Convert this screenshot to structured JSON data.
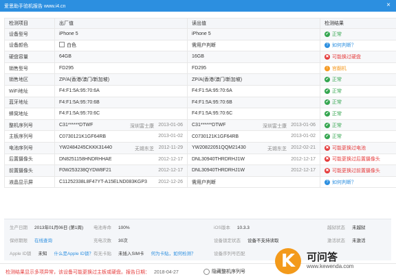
{
  "window": {
    "title": "爱思助手验机报告 www.i4.cn",
    "close": "×"
  },
  "table": {
    "headers": [
      "检测项目",
      "出厂值",
      "读出值",
      "检测结果"
    ],
    "rows": [
      {
        "item": "设备型号",
        "factory": "iPhone 5",
        "factory_note": "",
        "factory_date": "",
        "read": "iPhone 5",
        "read_note": "",
        "read_date": "",
        "result": "正常",
        "status": "ok",
        "checkbox": false
      },
      {
        "item": "设备颜色",
        "factory": "白色",
        "factory_note": "",
        "factory_date": "",
        "read": "需用户判断",
        "read_note": "",
        "read_date": "",
        "result": "如何判断？",
        "status": "q",
        "checkbox": true
      },
      {
        "item": "硬盘容量",
        "factory": "64GB",
        "factory_note": "",
        "factory_date": "",
        "read": "16GB",
        "read_note": "",
        "read_date": "",
        "result": "可能换过硬盘",
        "status": "bad",
        "checkbox": false
      },
      {
        "item": "销售型号",
        "factory": "FD295",
        "factory_note": "",
        "factory_date": "",
        "read": "FD295",
        "read_note": "",
        "read_date": "",
        "result": "官翻机",
        "status": "warn",
        "checkbox": false
      },
      {
        "item": "销售地区",
        "factory": "ZP/A(香港/澳门/新加坡)",
        "factory_note": "",
        "factory_date": "",
        "read": "ZP/A(香港/澳门/新加坡)",
        "read_note": "",
        "read_date": "",
        "result": "正常",
        "status": "ok",
        "checkbox": false
      },
      {
        "item": "WiFi地址",
        "factory": "F4:F1:5A:95:70:6A",
        "factory_note": "",
        "factory_date": "",
        "read": "F4:F1:5A:95:70:6A",
        "read_note": "",
        "read_date": "",
        "result": "正常",
        "status": "ok",
        "checkbox": false
      },
      {
        "item": "蓝牙地址",
        "factory": "F4:F1:5A:95:70:6B",
        "factory_note": "",
        "factory_date": "",
        "read": "F4:F1:5A:95:70:6B",
        "read_note": "",
        "read_date": "",
        "result": "正常",
        "status": "ok",
        "checkbox": false
      },
      {
        "item": "蜂窝地址",
        "factory": "F4:F1:5A:95:70:6C",
        "factory_note": "",
        "factory_date": "",
        "read": "F4:F1:5A:95:70:6C",
        "read_note": "",
        "read_date": "",
        "result": "正常",
        "status": "ok",
        "checkbox": false
      },
      {
        "item": "整机序列号",
        "factory": "C31******DTWF",
        "factory_note": "深圳富士康",
        "factory_date": "2013-01-06",
        "read": "C31******DTWF",
        "read_note": "深圳富士康",
        "read_date": "2013-01-06",
        "result": "正常",
        "status": "ok",
        "checkbox": false
      },
      {
        "item": "主板序列号",
        "factory": "C0730121K1GF64RB",
        "factory_note": "",
        "factory_date": "2013-01-02",
        "read": "C0730121K1GF64RB",
        "read_note": "",
        "read_date": "2013-01-02",
        "result": "正常",
        "status": "ok",
        "checkbox": false
      },
      {
        "item": "电池序列号",
        "factory": "YW2484245CKKK31440",
        "factory_note": "无锡东芝",
        "factory_date": "2012-11-29",
        "read": "YW20822051QQM21430",
        "read_note": "无锡东芝",
        "read_date": "2012-02-21",
        "result": "可能更换过电池",
        "status": "bad",
        "checkbox": false
      },
      {
        "item": "后置摄像头",
        "factory": "DN8251158HNDRHHAE",
        "factory_note": "",
        "factory_date": "2012-12-17",
        "read": "DNL30940THRDRHJ1W",
        "read_note": "",
        "read_date": "2012-12-17",
        "result": "可能更换过后置摄像头",
        "status": "bad",
        "checkbox": false
      },
      {
        "item": "前置摄像头",
        "factory": "F0W253238QYDW8F21",
        "factory_note": "",
        "factory_date": "2012-12-17",
        "read": "DNL30940THRDRHJ1W",
        "read_note": "",
        "read_date": "2012-12-17",
        "result": "可能更换过前置摄像头",
        "status": "bad",
        "checkbox": false
      },
      {
        "item": "液晶显示屏",
        "factory": "C11252338L8F47YT-A15ELND083KGP3",
        "factory_note": "",
        "factory_date": "2012-12-26",
        "read": "需用户判断",
        "read_note": "",
        "read_date": "",
        "result": "如何判断？",
        "status": "q",
        "checkbox": false
      }
    ]
  },
  "info": {
    "row1": [
      {
        "label": "生产日期",
        "value": "2013年01月06日 (第1周)"
      },
      {
        "label": "电池寿命",
        "value": "100%"
      },
      {
        "label": "iOS版本",
        "value": "10.3.3"
      },
      {
        "label": "越狱状态",
        "value": "未越狱"
      }
    ],
    "row2": [
      {
        "label": "保修期限",
        "value": "在线查询",
        "link": true
      },
      {
        "label": "充电次数",
        "value": "30次"
      },
      {
        "label": "设备锁定状态",
        "value": "设备不支持读取"
      },
      {
        "label": "激活状态",
        "value": "未激活"
      }
    ],
    "row3": [
      {
        "label": "Apple ID锁",
        "value": "未知",
        "extra": "什么是Apple ID锁？"
      },
      {
        "label": "有无卡贴",
        "value": "未插入SIM卡",
        "extra": "何为卡贴，如何检测？"
      },
      {
        "label": "设备序列号匹配",
        "value": ""
      }
    ]
  },
  "footer": {
    "warning": "检测结果显示多项异常，该设备可能更换过主板或硬盘。报告日期：",
    "date": "2018-04-27",
    "hide_serial": "隐藏整机序列号"
  },
  "brand": {
    "logo_letter": "K",
    "name": "可问答",
    "site": "www.kewenda.com"
  },
  "icons": {
    "ok": "✔",
    "q": "?",
    "bad": "✖",
    "warn": "!"
  },
  "colors": {
    "accent": "#2c8fe0",
    "ok": "#35a650",
    "bad": "#e53c3c",
    "warn": "#f59a23",
    "brand": "#f39a1b"
  }
}
